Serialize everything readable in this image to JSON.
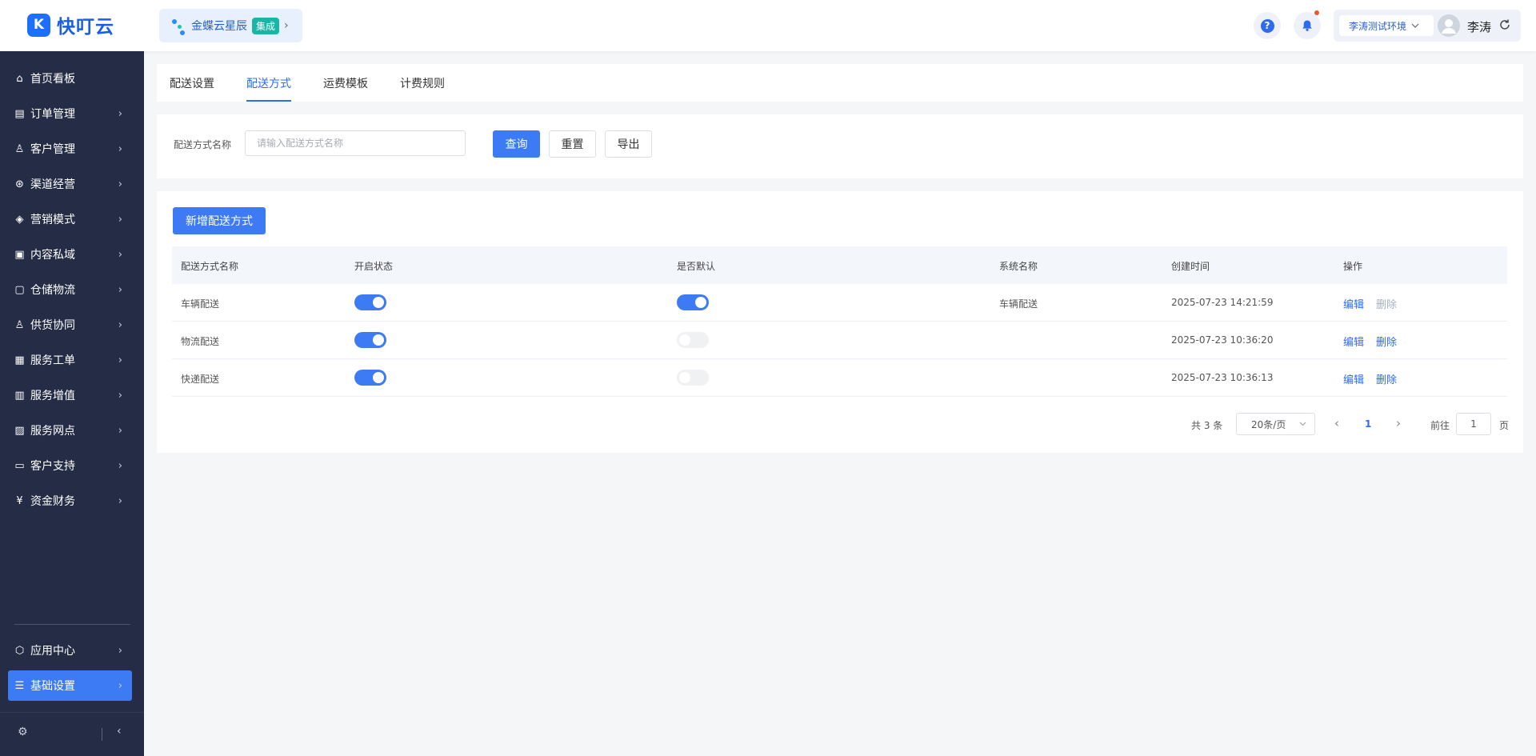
{
  "brand": {
    "logo_glyph": "K",
    "name": "快叮云"
  },
  "tenant": {
    "name": "金蝶云星辰",
    "badge": "集成",
    "chevron": "›"
  },
  "header": {
    "help_glyph": "?",
    "env": "李涛测试环境",
    "user": "李涛"
  },
  "sidebar": {
    "items": [
      {
        "label": "首页看板",
        "icon": "home-icon",
        "glyph": "⌂",
        "has_chevron": false
      },
      {
        "label": "订单管理",
        "icon": "order-icon",
        "glyph": "▤",
        "has_chevron": true
      },
      {
        "label": "客户管理",
        "icon": "user-icon",
        "glyph": "♙",
        "has_chevron": true
      },
      {
        "label": "渠道经营",
        "icon": "channel-icon",
        "glyph": "⊛",
        "has_chevron": true
      },
      {
        "label": "营销模式",
        "icon": "tag-icon",
        "glyph": "◈",
        "has_chevron": true
      },
      {
        "label": "内容私域",
        "icon": "image-icon",
        "glyph": "▣",
        "has_chevron": true
      },
      {
        "label": "仓储物流",
        "icon": "warehouse-icon",
        "glyph": "▢",
        "has_chevron": true
      },
      {
        "label": "供货协同",
        "icon": "supply-icon",
        "glyph": "♙",
        "has_chevron": true
      },
      {
        "label": "服务工单",
        "icon": "ticket-icon",
        "glyph": "▦",
        "has_chevron": true
      },
      {
        "label": "服务增值",
        "icon": "bag-icon",
        "glyph": "▥",
        "has_chevron": true
      },
      {
        "label": "服务网点",
        "icon": "store-icon",
        "glyph": "▨",
        "has_chevron": true
      },
      {
        "label": "客户支持",
        "icon": "support-icon",
        "glyph": "▭",
        "has_chevron": true
      },
      {
        "label": "资金财务",
        "icon": "yen-icon",
        "glyph": "¥",
        "has_chevron": true
      }
    ],
    "bottom_items": [
      {
        "label": "应用中心",
        "icon": "cube-icon",
        "glyph": "⬡",
        "has_chevron": true
      },
      {
        "label": "基础设置",
        "icon": "settings-list-icon",
        "glyph": "☰",
        "has_chevron": true,
        "active": true
      }
    ],
    "foot_left_glyph": "⚙",
    "foot_right_glyph": "‹"
  },
  "tabs": [
    {
      "label": "配送设置",
      "active": false
    },
    {
      "label": "配送方式",
      "active": true
    },
    {
      "label": "运费模板",
      "active": false
    },
    {
      "label": "计费规则",
      "active": false
    }
  ],
  "filter": {
    "label": "配送方式名称",
    "placeholder": "请输入配送方式名称",
    "query": "查询",
    "reset": "重置",
    "export": "导出"
  },
  "table": {
    "add_button": "新增配送方式",
    "columns": [
      "配送方式名称",
      "开启状态",
      "是否默认",
      "系统名称",
      "创建时间",
      "操作"
    ],
    "rows": [
      {
        "name": "车辆配送",
        "enabled": true,
        "is_default": true,
        "system_name": "车辆配送",
        "created": "2025-07-23 14:21:59",
        "edit": "编辑",
        "delete": "删除",
        "delete_disabled": true
      },
      {
        "name": "物流配送",
        "enabled": true,
        "is_default": false,
        "system_name": "",
        "created": "2025-07-23 10:36:20",
        "edit": "编辑",
        "delete": "删除",
        "delete_disabled": false
      },
      {
        "name": "快递配送",
        "enabled": true,
        "is_default": false,
        "system_name": "",
        "created": "2025-07-23 10:36:13",
        "edit": "编辑",
        "delete": "删除",
        "delete_disabled": false
      }
    ]
  },
  "pagination": {
    "total": "共 3 条",
    "page_size": "20条/页",
    "prev": "‹",
    "current": "1",
    "next": "›",
    "goto_label": "前往",
    "goto_value": "1",
    "goto_unit": "页"
  },
  "colors": {
    "primary": "#3d7bf4",
    "sidebar_bg": "#242d45"
  }
}
